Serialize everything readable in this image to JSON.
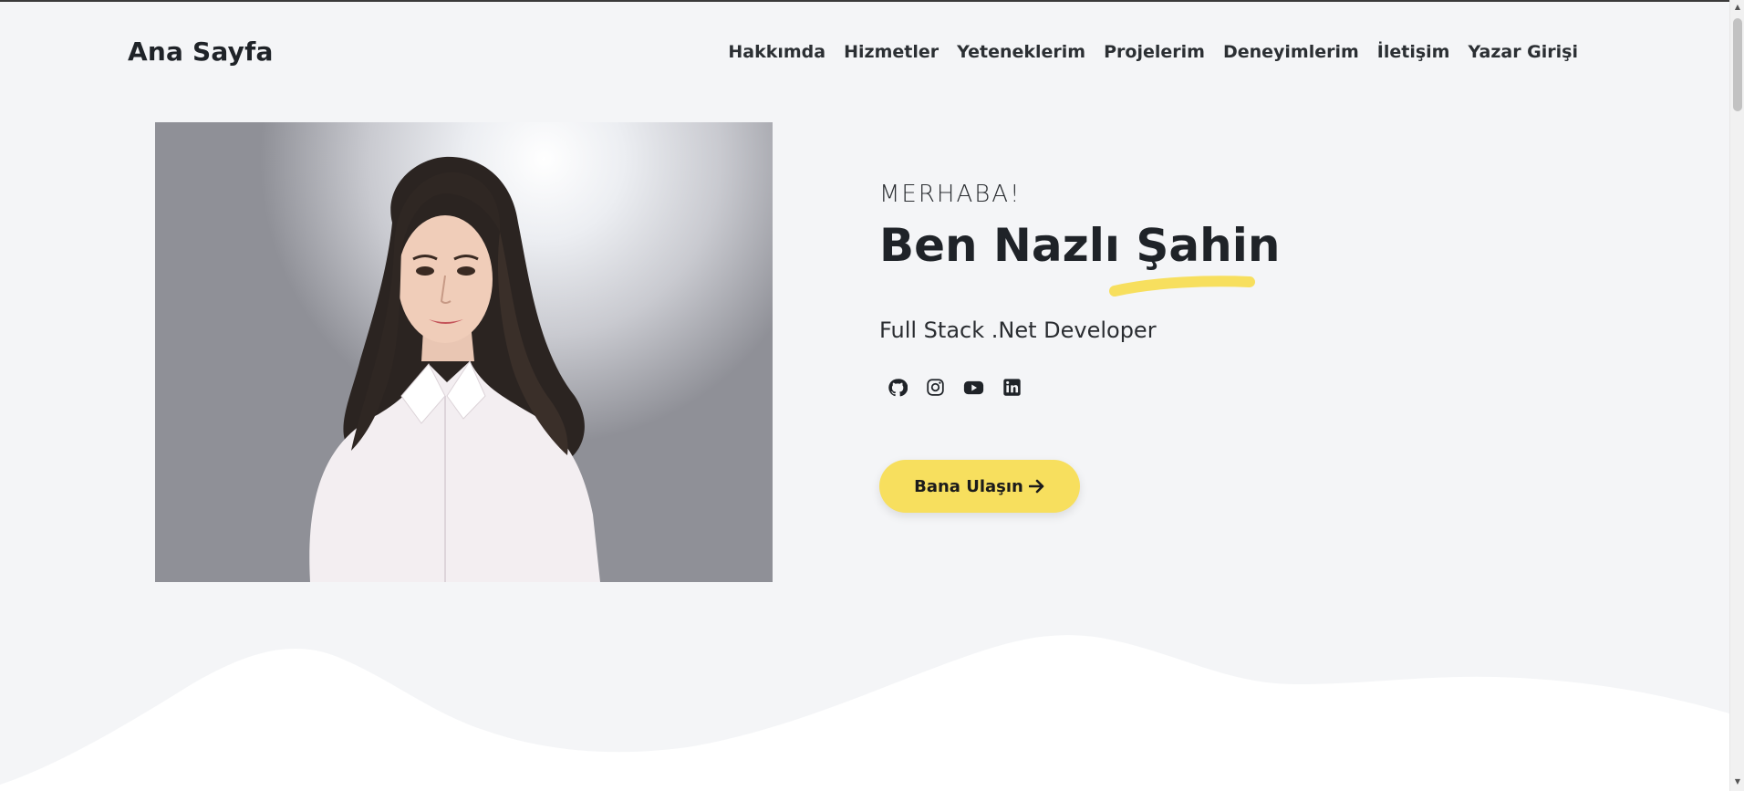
{
  "brand": "Ana Sayfa",
  "nav": [
    {
      "label": "Hakkımda"
    },
    {
      "label": "Hizmetler"
    },
    {
      "label": "Yeteneklerim"
    },
    {
      "label": "Projelerim"
    },
    {
      "label": "Deneyimlerim"
    },
    {
      "label": "İletişim"
    },
    {
      "label": "Yazar Girişi"
    }
  ],
  "hero": {
    "greeting": "MERHABA!",
    "headline": "Ben Nazlı Şahin",
    "role": "Full Stack .Net Developer",
    "socials": [
      "github-icon",
      "instagram-icon",
      "youtube-icon",
      "linkedin-icon"
    ],
    "cta_label": "Bana Ulaşın",
    "cta_icon": "arrow-right-icon"
  },
  "colors": {
    "background": "#f4f5f7",
    "accent": "#f7df5e",
    "text": "#1f2328",
    "wave": "#ffffff"
  }
}
